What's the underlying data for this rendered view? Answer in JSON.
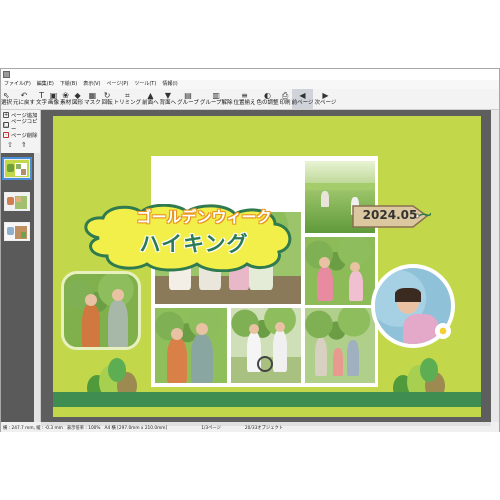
{
  "menu": [
    "ファイル(F)",
    "編集(E)",
    "下絵(B)",
    "表示(V)",
    "ページ(P)",
    "ツール(T)",
    "情報(I)"
  ],
  "toolbar": [
    {
      "label": "選択",
      "icon": "cursor-icon"
    },
    {
      "label": "元に戻す",
      "icon": "undo-icon"
    },
    {
      "label": "文字",
      "icon": "text-icon"
    },
    {
      "label": "画像",
      "icon": "image-icon"
    },
    {
      "label": "素材",
      "icon": "material-icon"
    },
    {
      "label": "図形",
      "icon": "shape-icon"
    },
    {
      "label": "マスク",
      "icon": "mask-icon"
    },
    {
      "label": "回転",
      "icon": "rotate-icon"
    },
    {
      "label": "トリミング",
      "icon": "crop-icon"
    },
    {
      "label": "前面へ",
      "icon": "bring-front-icon"
    },
    {
      "label": "背面へ",
      "icon": "send-back-icon"
    },
    {
      "label": "グループ",
      "icon": "group-icon"
    },
    {
      "label": "グループ解除",
      "icon": "ungroup-icon"
    },
    {
      "label": "位置揃え",
      "icon": "align-icon"
    },
    {
      "label": "色の調整",
      "icon": "color-adjust-icon"
    },
    {
      "label": "印刷",
      "icon": "print-icon"
    },
    {
      "label": "前ページ",
      "icon": "prev-page-icon"
    },
    {
      "label": "次ページ",
      "icon": "next-page-icon"
    }
  ],
  "sidebar": {
    "add_page": "ページ追加",
    "copy_page": "ページコピー",
    "delete_page": "ページ削除"
  },
  "page": {
    "title_line1": "ゴールデンウィーク",
    "title_line2": "ハイキング",
    "date": "2024.05"
  },
  "status": {
    "position": "横 : 247.7 mm, 縦 : -0.3 mm",
    "zoom": "表示倍率 : 100%",
    "paper": "A4 横 [297.0mm x 210.0mm]",
    "page": "1/3ページ",
    "objects": "20/33オブジェクト"
  },
  "colors": {
    "page_bg": "#c2d84a",
    "stripe": "#3f8d50",
    "title_orange": "#e89520",
    "title_green": "#2a7a55"
  }
}
